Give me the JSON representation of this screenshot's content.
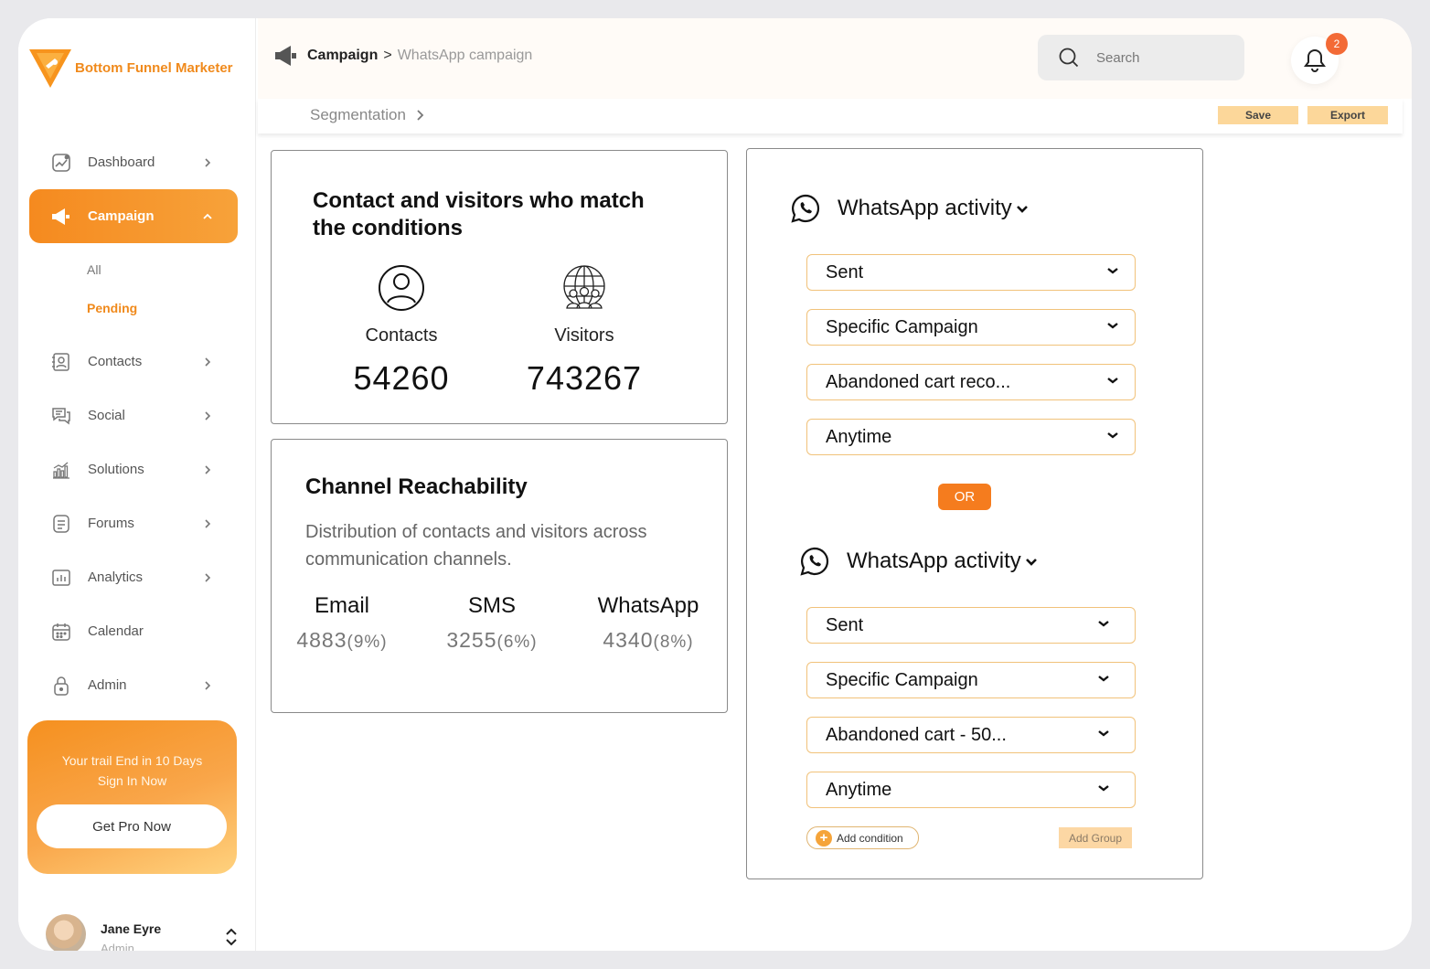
{
  "brand": {
    "name": "Bottom Funnel Marketer",
    "accent": "#f58a1f"
  },
  "sidebar": {
    "items": [
      {
        "label": "Dashboard",
        "icon": "chart-line-icon"
      },
      {
        "label": "Campaign",
        "icon": "megaphone-icon",
        "active": true
      },
      {
        "label": "Contacts",
        "icon": "contact-book-icon"
      },
      {
        "label": "Social",
        "icon": "chat-bubbles-icon"
      },
      {
        "label": "Solutions",
        "icon": "bar-graph-icon"
      },
      {
        "label": "Forums",
        "icon": "document-icon"
      },
      {
        "label": "Analytics",
        "icon": "analytics-icon"
      },
      {
        "label": "Calendar",
        "icon": "calendar-icon"
      },
      {
        "label": "Admin",
        "icon": "lock-icon"
      }
    ],
    "campaign_sub": [
      {
        "label": "All"
      },
      {
        "label": "Pending"
      }
    ]
  },
  "trial": {
    "line1": "Your trail End in 10 Days",
    "line2": "Sign In Now",
    "button": "Get Pro Now"
  },
  "user": {
    "name": "Jane Eyre",
    "role": "Admin"
  },
  "header": {
    "breadcrumb_root": "Campaign",
    "breadcrumb_sep": ">",
    "breadcrumb_current": "WhatsApp campaign",
    "search_placeholder": "Search",
    "notifications": "2"
  },
  "subbar": {
    "segmentation": "Segmentation",
    "save": "Save",
    "export": "Export"
  },
  "match_card": {
    "title": "Contact and visitors who match the conditions",
    "contacts_label": "Contacts",
    "contacts_value": "54260",
    "visitors_label": "Visitors",
    "visitors_value": "743267"
  },
  "reach_card": {
    "title": "Channel Reachability",
    "description": "Distribution of contacts and visitors across communication channels.",
    "channels": [
      {
        "label": "Email",
        "value": "4883",
        "pct": "(9%)"
      },
      {
        "label": "SMS",
        "value": "3255",
        "pct": "(6%)"
      },
      {
        "label": "WhatsApp",
        "value": "4340",
        "pct": "(8%)"
      }
    ]
  },
  "conditions": {
    "group1": {
      "title": "WhatsApp activity",
      "selects": [
        "Sent",
        "Specific Campaign",
        "Abandoned cart reco...",
        "Anytime"
      ]
    },
    "or_label": "OR",
    "group2": {
      "title": "WhatsApp activity",
      "selects": [
        "Sent",
        "Specific Campaign",
        "Abandoned cart - 50...",
        "Anytime"
      ]
    },
    "add_condition": "Add condition",
    "add_group": "Add Group"
  }
}
